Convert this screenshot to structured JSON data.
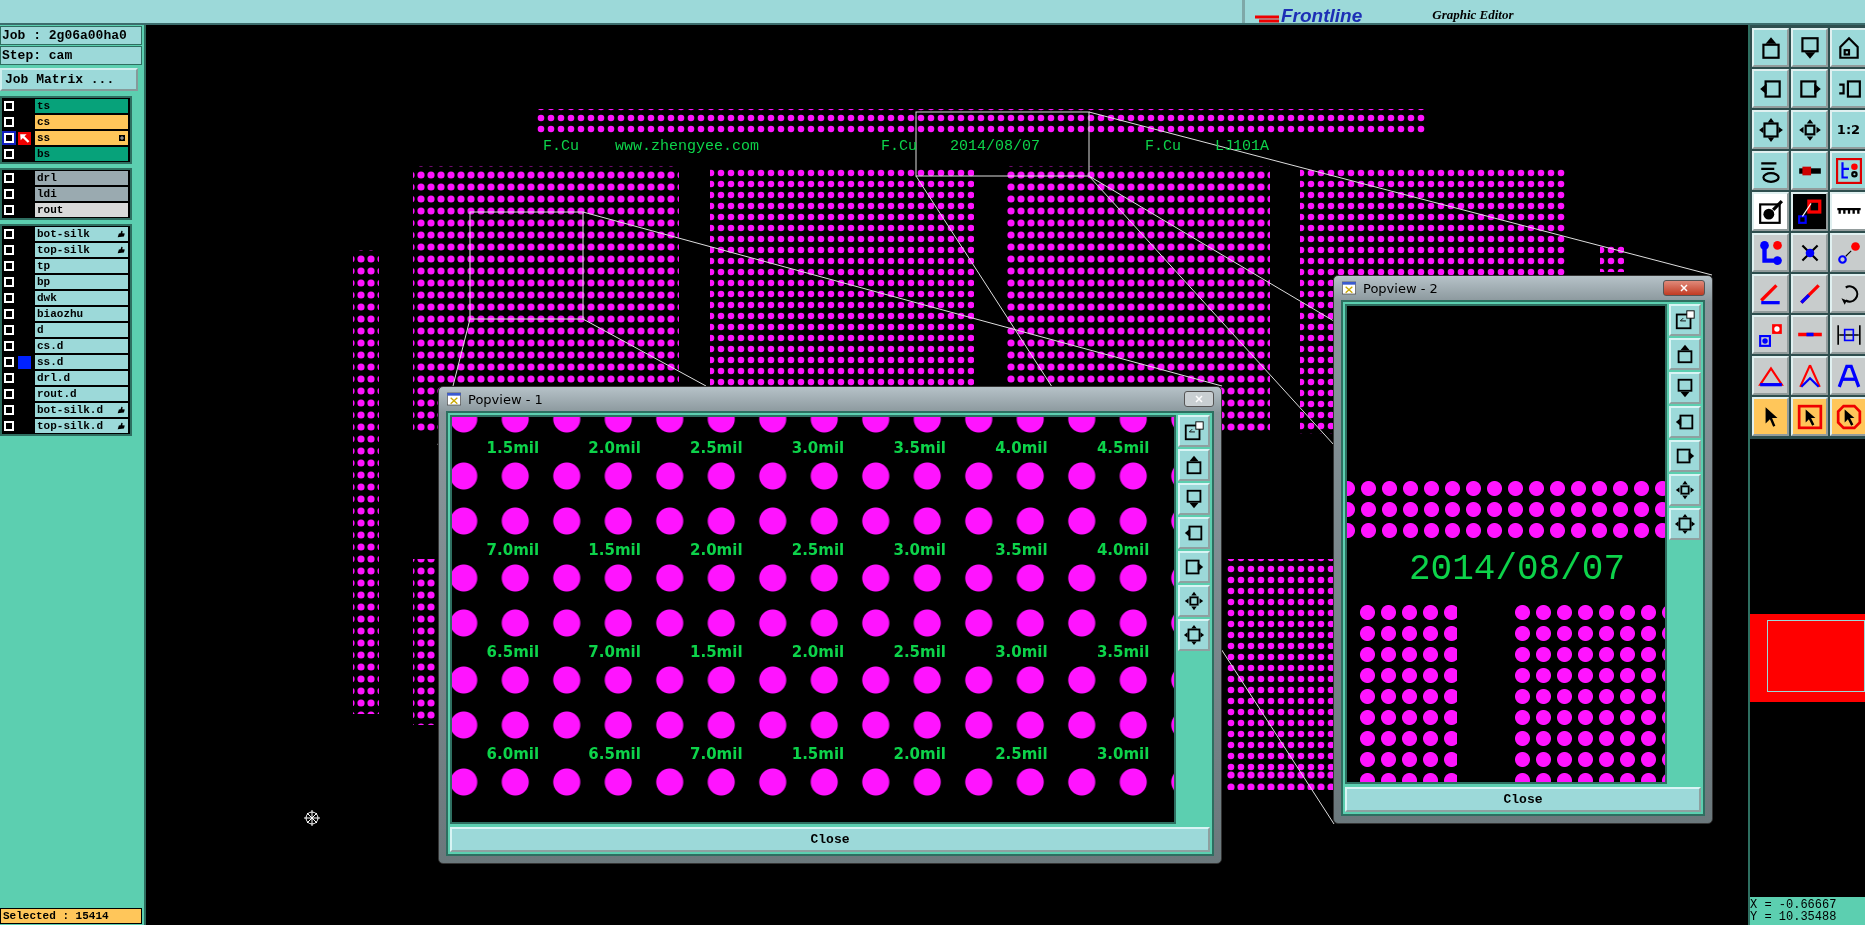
{
  "title_panel": {
    "logo": "Frontline",
    "subtitle": "Graphic Editor"
  },
  "left_panel": {
    "job": "Job : 2g06a00ha0",
    "step": "Step: cam",
    "matrix_button": "Job Matrix ...",
    "layer_groups": [
      {
        "layers": [
          {
            "name": "ts",
            "color": "#07a27a",
            "checked": false,
            "work_layer": false,
            "displayed": false,
            "flagged": false,
            "expandable": false
          },
          {
            "name": "cs",
            "color": "#ffc65a",
            "checked": false,
            "work_layer": false,
            "displayed": false,
            "flagged": false,
            "expandable": false
          },
          {
            "name": "ss",
            "color": "#ffc65a",
            "checked": false,
            "work_layer": true,
            "displayed": false,
            "flagged": false,
            "expandable": true
          },
          {
            "name": "bs",
            "color": "#07a27a",
            "checked": false,
            "work_layer": false,
            "displayed": false,
            "flagged": false,
            "expandable": false
          }
        ]
      },
      {
        "layers": [
          {
            "name": "drl",
            "color": "#9aaab0",
            "checked": false,
            "work_layer": false,
            "displayed": false,
            "flagged": false,
            "expandable": false
          },
          {
            "name": "ldi",
            "color": "#9aaab0",
            "checked": false,
            "work_layer": false,
            "displayed": false,
            "flagged": false,
            "expandable": false
          },
          {
            "name": "rout",
            "color": "#d9d9d9",
            "checked": false,
            "work_layer": false,
            "displayed": false,
            "flagged": false,
            "expandable": false
          }
        ]
      },
      {
        "layers": [
          {
            "name": "bot-silk",
            "color": "#9cd9d9",
            "checked": false,
            "work_layer": false,
            "displayed": false,
            "flagged": true,
            "expandable": false
          },
          {
            "name": "top-silk",
            "color": "#9cd9d9",
            "checked": false,
            "work_layer": false,
            "displayed": false,
            "flagged": true,
            "expandable": false
          },
          {
            "name": "tp",
            "color": "#9cd9d9",
            "checked": false,
            "work_layer": false,
            "displayed": false,
            "flagged": false,
            "expandable": false
          },
          {
            "name": "bp",
            "color": "#9cd9d9",
            "checked": false,
            "work_layer": false,
            "displayed": false,
            "flagged": false,
            "expandable": false
          },
          {
            "name": "dwk",
            "color": "#9cd9d9",
            "checked": false,
            "work_layer": false,
            "displayed": false,
            "flagged": false,
            "expandable": false
          },
          {
            "name": "biaozhu",
            "color": "#9cd9d9",
            "checked": false,
            "work_layer": false,
            "displayed": false,
            "flagged": false,
            "expandable": false
          },
          {
            "name": "d",
            "color": "#9cd9d9",
            "checked": false,
            "work_layer": false,
            "displayed": false,
            "flagged": false,
            "expandable": false
          },
          {
            "name": "cs.d",
            "color": "#9cd9d9",
            "checked": false,
            "work_layer": false,
            "displayed": false,
            "flagged": false,
            "expandable": false
          },
          {
            "name": "ss.d",
            "color": "#9cd9d9",
            "checked": false,
            "work_layer": false,
            "displayed": true,
            "flagged": false,
            "expandable": false
          },
          {
            "name": "drl.d",
            "color": "#9cd9d9",
            "checked": false,
            "work_layer": false,
            "displayed": false,
            "flagged": false,
            "expandable": false
          },
          {
            "name": "rout.d",
            "color": "#9cd9d9",
            "checked": false,
            "work_layer": false,
            "displayed": false,
            "flagged": false,
            "expandable": false
          },
          {
            "name": "bot-silk.d",
            "color": "#9cd9d9",
            "checked": false,
            "work_layer": false,
            "displayed": false,
            "flagged": true,
            "expandable": false
          },
          {
            "name": "top-silk.d",
            "color": "#9cd9d9",
            "checked": false,
            "work_layer": false,
            "displayed": false,
            "flagged": true,
            "expandable": false
          }
        ]
      }
    ],
    "selected": "Selected : 15414"
  },
  "canvas": {
    "board_texts": [
      "F.Cu",
      "www.zhengyee.com",
      "F.Cu",
      "2014/08/07",
      "F.Cu",
      "LJ101A"
    ]
  },
  "popviews": [
    {
      "title": "Popview - 1",
      "close": "Close",
      "labels": [
        [
          "1.5mil",
          "2.0mil",
          "2.5mil",
          "3.0mil",
          "3.5mil",
          "4.0mil",
          "4.5mil"
        ],
        [
          "7.0mil",
          "1.5mil",
          "2.0mil",
          "2.5mil",
          "3.0mil",
          "3.5mil",
          "4.0mil"
        ],
        [
          "6.5mil",
          "7.0mil",
          "1.5mil",
          "2.0mil",
          "2.5mil",
          "3.0mil",
          "3.5mil"
        ],
        [
          "6.0mil",
          "6.5mil",
          "7.0mil",
          "1.5mil",
          "2.0mil",
          "2.5mil",
          "3.0mil"
        ]
      ]
    },
    {
      "title": "Popview - 2",
      "close": "Close",
      "text": "2014/08/07"
    }
  ],
  "right_toolbar": {
    "ratio_label": "1:2"
  },
  "coordinates": {
    "x": "X = -0.66667",
    "y": "Y = 10.35488"
  }
}
